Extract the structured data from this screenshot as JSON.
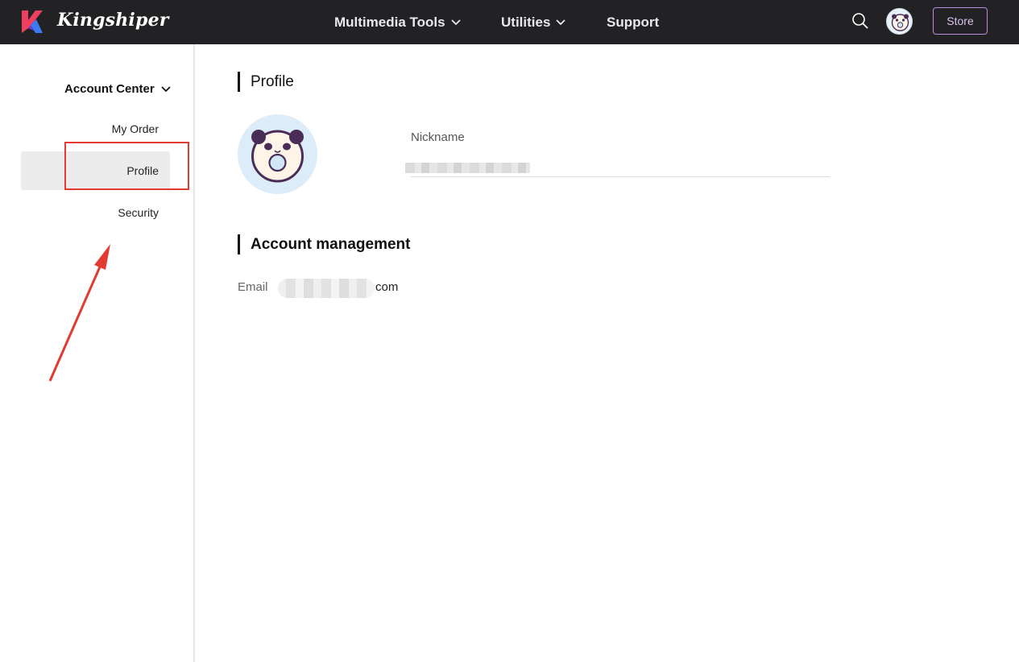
{
  "header": {
    "brand": "Kingshiper",
    "nav": [
      {
        "label": "Multimedia Tools",
        "has_dropdown": true
      },
      {
        "label": "Utilities",
        "has_dropdown": true
      },
      {
        "label": "Support",
        "has_dropdown": false
      }
    ],
    "store_label": "Store",
    "icons": [
      "search-icon",
      "user-avatar"
    ],
    "colors": {
      "bar": "#222225",
      "store_border": "#b98bdc"
    }
  },
  "sidebar": {
    "section": "Account Center",
    "items": [
      {
        "label": "My Order",
        "active": false
      },
      {
        "label": "Profile",
        "active": true
      },
      {
        "label": "Security",
        "active": false
      }
    ]
  },
  "profile": {
    "title": "Profile",
    "nickname_label": "Nickname",
    "nickname_value": ""
  },
  "account": {
    "title": "Account management",
    "email_label": "Email",
    "email_visible_suffix": "com"
  },
  "annotation": {
    "highlight_color": "#e23b32"
  }
}
